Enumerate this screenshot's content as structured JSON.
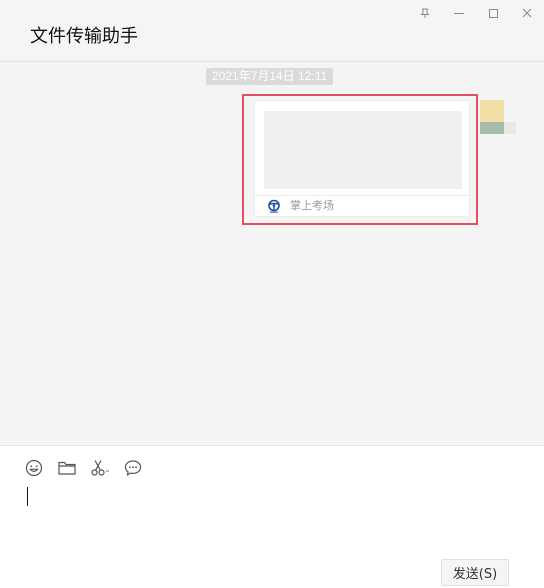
{
  "window": {
    "title": "文件传输助手",
    "controls": [
      "pin-icon",
      "minimize-icon",
      "maximize-icon",
      "close-icon"
    ]
  },
  "chat": {
    "timestamp": "2021年7月14日 12:11",
    "message_card": {
      "source_name": "掌上考场",
      "source_icon": "steering-wheel-logo-icon"
    }
  },
  "input": {
    "toolbar": [
      "emoji-icon",
      "folder-icon",
      "scissors-icon",
      "chat-bubble-icon"
    ],
    "send_label": "发送(S)"
  },
  "colors": {
    "highlight": "#e0525e",
    "logo_blue": "#1a4fa0",
    "timestamp_bg": "#dadada"
  }
}
